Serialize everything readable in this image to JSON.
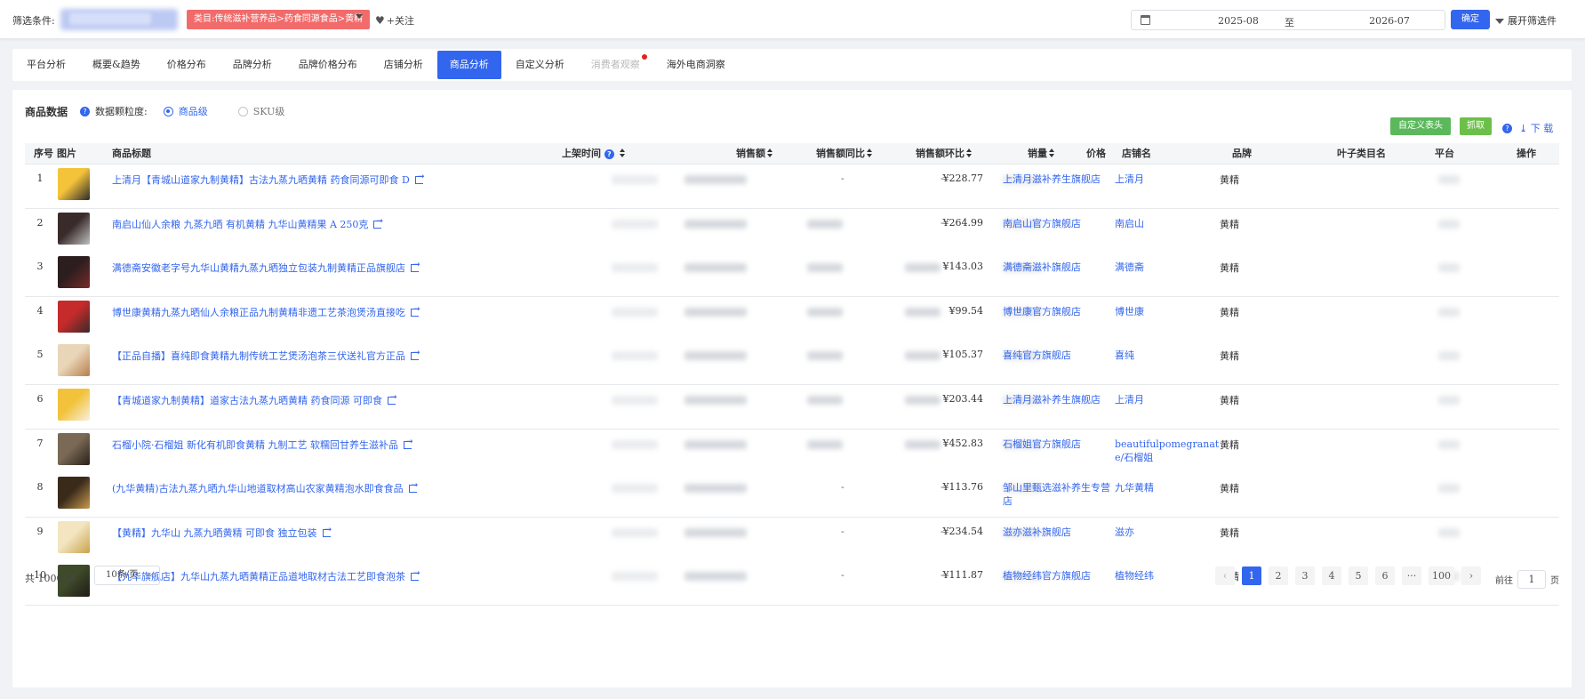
{
  "filter": {
    "label": "筛选条件:",
    "category_tag": "类目:传统滋补营养品>药食同源食品>黄精",
    "follow_label": "+关注",
    "date_start": "2025-08",
    "date_sep": "至",
    "date_end": "2026-07",
    "confirm_label": "确定",
    "expand_label": "展开筛选件"
  },
  "tabs": [
    {
      "label": "平台分析"
    },
    {
      "label": "概要&趋势"
    },
    {
      "label": "价格分布"
    },
    {
      "label": "品牌分析"
    },
    {
      "label": "品牌价格分布"
    },
    {
      "label": "店铺分析"
    },
    {
      "label": "商品分析"
    },
    {
      "label": "自定义分析"
    },
    {
      "label": "消费者观察"
    },
    {
      "label": "海外电商洞察"
    }
  ],
  "panel": {
    "title": "商品数据",
    "granularity_label": "数据颗粒度:",
    "option_item": "商品级",
    "option_sku": "SKU级",
    "custom_header_btn": "自定义表头",
    "fetch_btn": "抓取",
    "download_label": "下 载"
  },
  "columns": {
    "idx": "序号",
    "img": "图片",
    "title": "商品标题",
    "listed": "上架时间",
    "sales": "销售额",
    "yoy": "销售额同比",
    "mom": "销售额环比",
    "volume": "销量",
    "price": "价格",
    "shop": "店铺名",
    "brand": "品牌",
    "leaf": "叶子类目名",
    "platform": "平台",
    "action": "操作"
  },
  "rows": [
    {
      "idx": "1",
      "title": "上清月【青城山道家九制黄精】古法九蒸九晒黄精 药食同源可即食 D",
      "yoy": "-",
      "mom": "-",
      "price": "¥228.77",
      "shop": "上清月滋补养生旗舰店",
      "brand": "上清月",
      "leaf": "黄精"
    },
    {
      "idx": "2",
      "title": "南启山仙人余粮 九蒸九晒 有机黄精 九华山黄精果 A 250克",
      "yoy": "",
      "mom": "-",
      "price": "¥264.99",
      "shop": "南启山官方旗舰店",
      "brand": "南启山",
      "leaf": "黄精"
    },
    {
      "idx": "3",
      "title": "满德斋安徽老字号九华山黄精九蒸九晒独立包装九制黄精正品旗舰店",
      "yoy": "",
      "mom": "",
      "price": "¥143.03",
      "shop": "满德斋滋补旗舰店",
      "brand": "满德斋",
      "leaf": "黄精"
    },
    {
      "idx": "4",
      "title": "博世康黄精九蒸九晒仙人余粮正品九制黄精非遗工艺茶泡煲汤直接吃",
      "yoy": "",
      "mom": "",
      "price": "¥99.54",
      "shop": "博世康官方旗舰店",
      "brand": "博世康",
      "leaf": "黄精"
    },
    {
      "idx": "5",
      "title": "【正品自播】喜纯即食黄精九制传统工艺煲汤泡茶三伏送礼官方正品",
      "yoy": "",
      "mom": "",
      "price": "¥105.37",
      "shop": "喜纯官方旗舰店",
      "brand": "喜纯",
      "leaf": "黄精"
    },
    {
      "idx": "6",
      "title": "【青城道家九制黄精】道家古法九蒸九晒黄精 药食同源 可即食",
      "yoy": "",
      "mom": "",
      "price": "¥203.44",
      "shop": "上清月滋补养生旗舰店",
      "brand": "上清月",
      "leaf": "黄精"
    },
    {
      "idx": "7",
      "title": "石榴小院·石榴姐 新化有机即食黄精 九制工艺 软糯回甘养生滋补品",
      "yoy": "",
      "mom": "",
      "price": "¥452.83",
      "shop": "石榴姐官方旗舰店",
      "brand": "beautifulpomegranate/石榴姐",
      "leaf": "黄精"
    },
    {
      "idx": "8",
      "title": "(九华黄精)古法九蒸九晒九华山地道取材高山农家黄精泡水即食食品",
      "yoy": "-",
      "mom": "-",
      "price": "¥113.76",
      "shop": "邹山里甄选滋补养生专营店",
      "brand": "九华黄精",
      "leaf": "黄精"
    },
    {
      "idx": "9",
      "title": "【黄精】九华山 九蒸九晒黄精 可即食 独立包装",
      "yoy": "-",
      "mom": "-",
      "price": "¥234.54",
      "shop": "滋亦滋补旗舰店",
      "brand": "滋亦",
      "leaf": "黄精"
    },
    {
      "idx": "10",
      "title": "【九华旗舰店】九华山九蒸九晒黄精正品道地取材古法工艺即食泡茶",
      "yoy": "-",
      "mom": "-",
      "price": "¥111.87",
      "shop": "植物经纬官方旗舰店",
      "brand": "植物经纬",
      "leaf": "黄精"
    }
  ],
  "footer": {
    "total": "共 1000 条",
    "page_size": "10条/页",
    "pages": [
      "1",
      "2",
      "3",
      "4",
      "5",
      "6",
      "···",
      "100"
    ],
    "goto_prefix": "前往",
    "goto_value": "1",
    "goto_suffix": "页"
  },
  "colors": {
    "accent": "#3366ee",
    "tag_red": "#f26b6b",
    "green": "#5cb85c"
  }
}
